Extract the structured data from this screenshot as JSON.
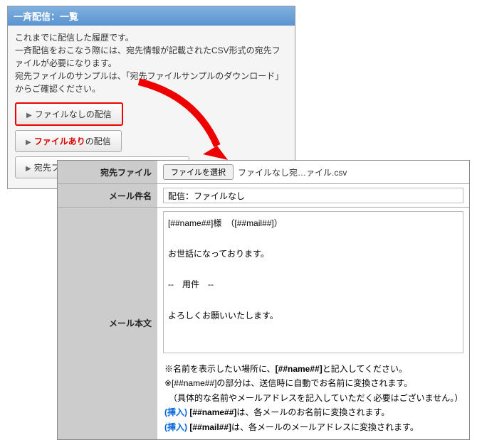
{
  "panel1": {
    "title": "一斉配信：一覧",
    "desc_l1": "これまでに配信した履歴です。",
    "desc_l2": "一斉配信をおこなう際には、宛先情報が記載されたCSV形式の宛先ファイルが必要になります。",
    "desc_l3": "宛先ファイルのサンプルは、「宛先ファイルサンプルのダウンロード」からご確認ください。",
    "btn1": "ファイルなしの配信",
    "btn2_strong": "ファイルあり",
    "btn2_rest": "の配信",
    "btn3": "宛先ファイルサンプルのダウンロード"
  },
  "form": {
    "row1_label": "宛先ファイル",
    "file_button": "ファイルを選択",
    "file_name": "ファイルなし宛…ァイル.csv",
    "row2_label": "メール件名",
    "subject_value": "配信：ファイルなし",
    "row3_label": "メール本文",
    "body_value": "[##name##]様　（[##mail##]）\n\nお世話になっております。\n\n--　用件　--\n\nよろしくお願いいたします。",
    "note1_a": "※名前を表示したい場所に、",
    "note1_ph": "[##name##]",
    "note1_b": "と記入してください。",
    "note2": "※[##name##]の部分は、送信時に自動でお名前に変換されます。",
    "note3": "　（具体的な名前やメールアドレスを記入していただく必要はございません。）",
    "insert_label": "(挿入)",
    "note4_ph": "[##name##]",
    "note4_b": "は、各メールのお名前に変換されます。",
    "note5_ph": "[##mail##]",
    "note5_b": "は、各メールのメールアドレスに変換されます。"
  }
}
